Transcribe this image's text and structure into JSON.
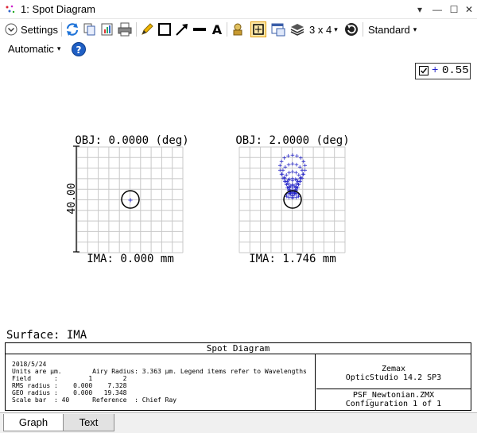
{
  "window": {
    "title": "1: Spot Diagram",
    "controls": [
      "▾",
      "—",
      "☐",
      "✕"
    ]
  },
  "toolbar": {
    "settings_label": "Settings",
    "layout_label": "3 x 4",
    "scale_mode": "Standard",
    "auto_label": "Automatic"
  },
  "legend": {
    "checked": true,
    "value": "0.55"
  },
  "plots": [
    {
      "obj_label": "OBJ: 0.0000 (deg)",
      "ima_label": "IMA: 0.000 mm"
    },
    {
      "obj_label": "OBJ: 2.0000 (deg)",
      "ima_label": "IMA: 1.746 mm"
    }
  ],
  "scale_bar_label": "40.00",
  "surface_label": "Surface: IMA",
  "info": {
    "title": "Spot Diagram",
    "date": "2018/5/24",
    "units_line": "Units are µm.        Airy Radius: 3.363 µm. Legend items refer to Wavelengths",
    "field_line": "Field      :        1        2",
    "rms_line": "RMS radius :    0.000    7.328",
    "geo_line": "GEO radius :    0.000   19.348",
    "scale_line": "Scale bar  : 40      Reference  : Chief Ray",
    "software_1": "Zemax",
    "software_2": "OpticStudio 14.2 SP3",
    "file": "PSF_Newtonian.ZMX",
    "config": "Configuration 1 of 1"
  },
  "tabs": [
    "Graph",
    "Text"
  ],
  "colors": {
    "ray_color": "#2323c8",
    "grid_color": "#c8c8c8"
  }
}
